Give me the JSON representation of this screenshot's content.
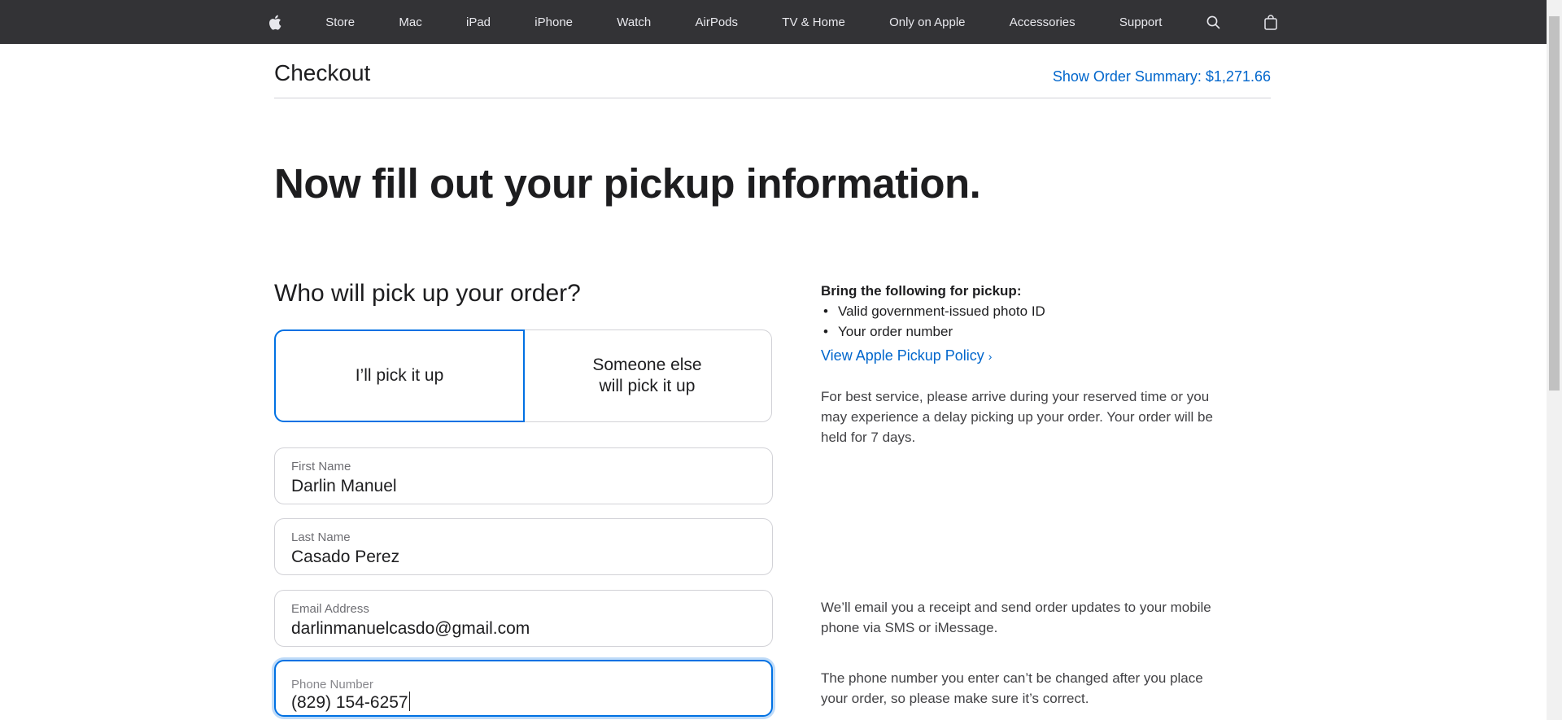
{
  "nav": {
    "apple_icon": "apple-logo-icon",
    "items": [
      "Store",
      "Mac",
      "iPad",
      "iPhone",
      "Watch",
      "AirPods",
      "TV & Home",
      "Only on Apple",
      "Accessories",
      "Support"
    ],
    "search_icon": "search-icon",
    "bag_icon": "shopping-bag-icon"
  },
  "header": {
    "title": "Checkout",
    "order_summary": "Show Order Summary: $1,271.66"
  },
  "headline": "Now fill out your pickup information.",
  "pickup": {
    "heading": "Who will pick up your order?",
    "option_self": "I’ll pick it up",
    "option_other_line1": "Someone else",
    "option_other_line2": "will pick it up",
    "selected": "I’ll pick it up"
  },
  "form": {
    "first_name": {
      "label": "First Name",
      "value": "Darlin Manuel"
    },
    "last_name": {
      "label": "Last Name",
      "value": "Casado Perez"
    },
    "email": {
      "label": "Email Address",
      "value": "darlinmanuelcasdo@gmail.com"
    },
    "phone": {
      "label": "Phone Number",
      "value": "(829) 154-6257"
    }
  },
  "info": {
    "bring_title": "Bring the following for pickup:",
    "bring_items": [
      "Valid government-issued photo ID",
      "Your order number"
    ],
    "policy_link": "View Apple Pickup Policy",
    "policy_chevron": "›",
    "best_service": "For best service, please arrive during your reserved time or you may experience a delay picking up your order. Your order will be held for 7 days.",
    "email_note": "We’ll email you a receipt and send order updates to your mobile phone via SMS or iMessage.",
    "phone_note": "The phone number you enter can’t be changed after you place your order, so please make sure it’s correct."
  },
  "colors": {
    "nav_bg": "#333336",
    "link": "#0066cc",
    "focus": "#0071e3",
    "text": "#1d1d1f"
  }
}
